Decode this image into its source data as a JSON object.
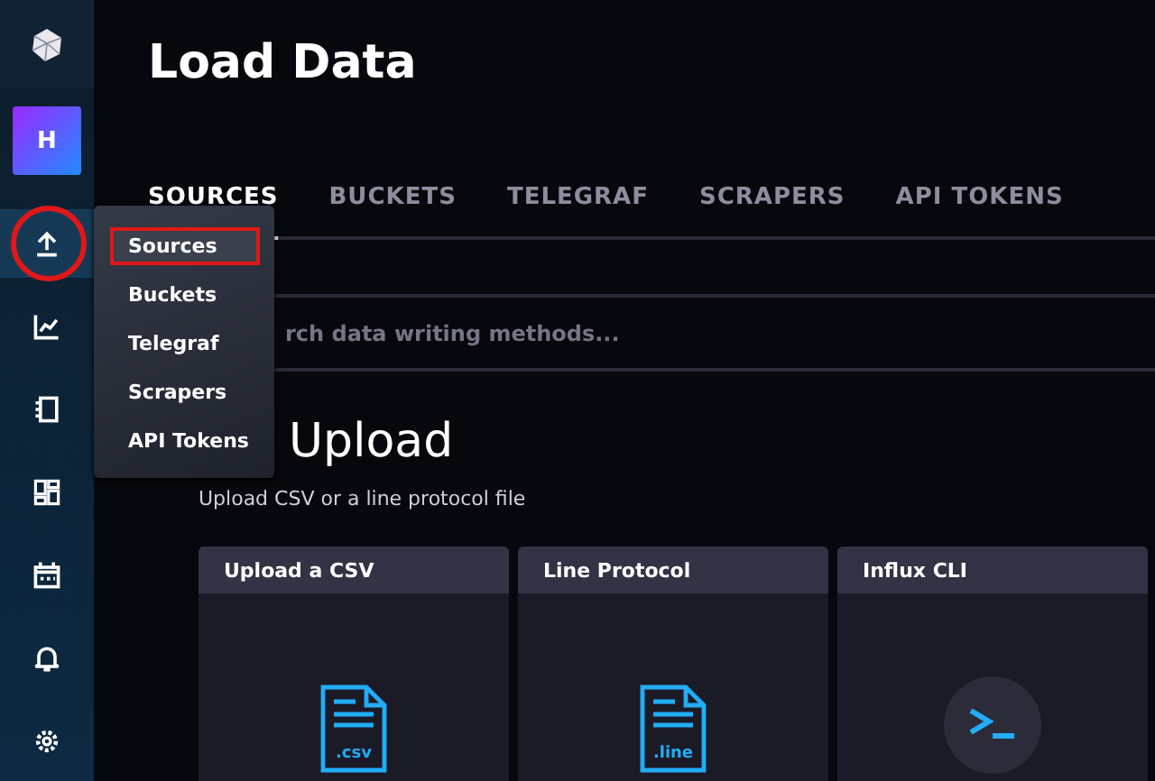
{
  "sidebar": {
    "avatar": "H",
    "items": [
      {
        "selected": true
      },
      {
        "selected": false
      },
      {
        "selected": false
      },
      {
        "selected": false
      },
      {
        "selected": false
      },
      {
        "selected": false
      },
      {
        "selected": false
      }
    ]
  },
  "menu": {
    "items": [
      {
        "label": "Sources",
        "selected": true
      },
      {
        "label": "Buckets",
        "selected": false
      },
      {
        "label": "Telegraf",
        "selected": false
      },
      {
        "label": "Scrapers",
        "selected": false
      },
      {
        "label": "API Tokens",
        "selected": false
      }
    ]
  },
  "page": {
    "title": "Load Data"
  },
  "tabs": [
    {
      "label": "SOURCES",
      "selected": true
    },
    {
      "label": "BUCKETS",
      "selected": false
    },
    {
      "label": "TELEGRAF",
      "selected": false
    },
    {
      "label": "SCRAPERS",
      "selected": false
    },
    {
      "label": "API TOKENS",
      "selected": false
    }
  ],
  "search": {
    "placeholder": "rch data writing methods..."
  },
  "section": {
    "title": "Upload",
    "subtitle": "Upload CSV or a line protocol file"
  },
  "cards": [
    {
      "title": "Upload a CSV",
      "kind": "file",
      "extension": ".csv"
    },
    {
      "title": "Line Protocol",
      "kind": "file",
      "extension": ".line"
    },
    {
      "title": "Influx CLI",
      "kind": "terminal"
    }
  ]
}
